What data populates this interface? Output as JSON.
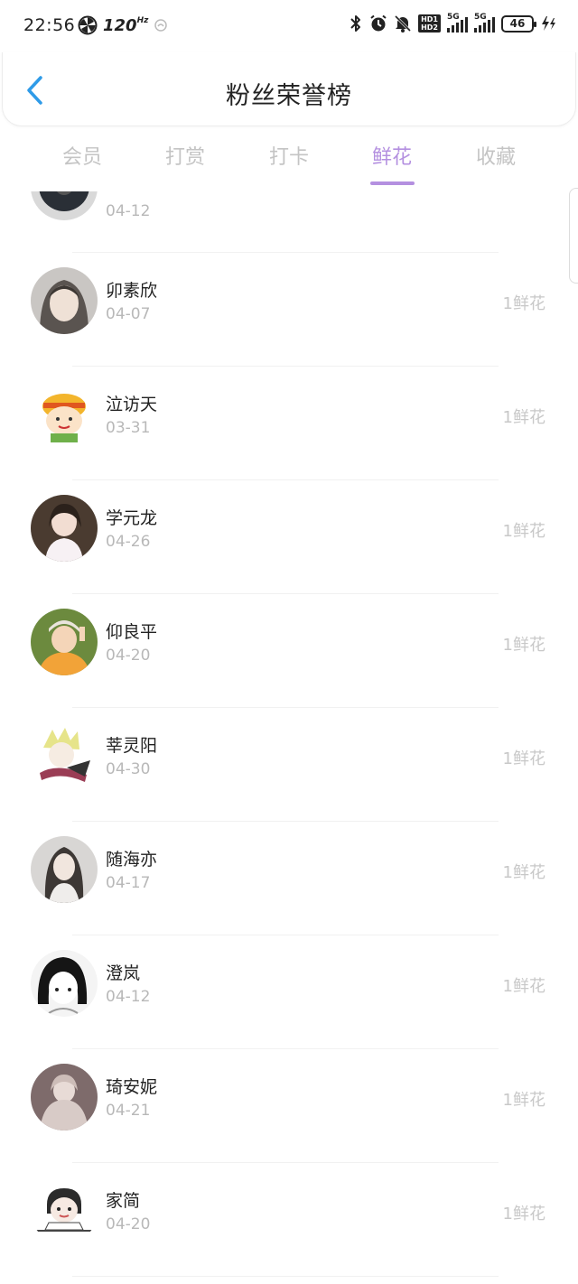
{
  "status_bar": {
    "time": "22:56",
    "refresh_rate": "120",
    "refresh_unit": "Hz",
    "hd_top": "HD1",
    "hd_bottom": "HD2",
    "signal1_label": "5G",
    "signal2_label": "5G",
    "battery": "46"
  },
  "header": {
    "title": "粉丝荣誉榜",
    "back_icon": "chevron-left-icon"
  },
  "tabs": [
    {
      "label": "会员",
      "active": false
    },
    {
      "label": "打赏",
      "active": false
    },
    {
      "label": "打卡",
      "active": false
    },
    {
      "label": "鲜花",
      "active": true
    },
    {
      "label": "收藏",
      "active": false
    }
  ],
  "colors": {
    "accent": "#b490e0",
    "back_icon": "#2f9be8",
    "muted_text": "#b8b8b8"
  },
  "list": [
    {
      "name": "",
      "date": "04-12",
      "count": ""
    },
    {
      "name": "卯素欣",
      "date": "04-07",
      "count": "1鲜花"
    },
    {
      "name": "泣访天",
      "date": "03-31",
      "count": "1鲜花"
    },
    {
      "name": "学元龙",
      "date": "04-26",
      "count": "1鲜花"
    },
    {
      "name": "仰良平",
      "date": "04-20",
      "count": "1鲜花"
    },
    {
      "name": "莘灵阳",
      "date": "04-30",
      "count": "1鲜花"
    },
    {
      "name": "随海亦",
      "date": "04-17",
      "count": "1鲜花"
    },
    {
      "name": "澄岚",
      "date": "04-12",
      "count": "1鲜花"
    },
    {
      "name": "琦安妮",
      "date": "04-21",
      "count": "1鲜花"
    },
    {
      "name": "家简",
      "date": "04-20",
      "count": "1鲜花"
    }
  ]
}
